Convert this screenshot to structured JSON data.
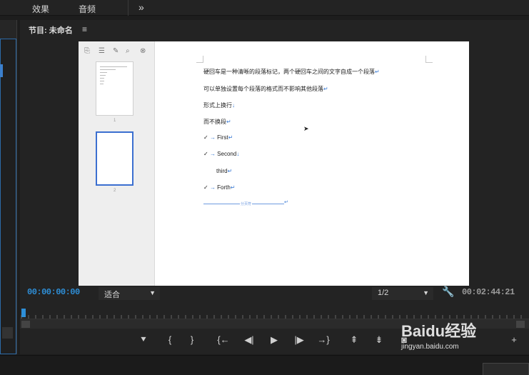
{
  "topbar": {
    "tab_effects": "效果",
    "tab_audio": "音频",
    "more_icon": "double-chevron-right"
  },
  "monitor": {
    "title": "节目: 未命名",
    "menu_icon": "hamburger",
    "timecode_current": "00:00:00:00",
    "fit_label": "适合",
    "resolution_label": "1/2",
    "timecode_duration": "00:02:44:21",
    "accent_color": "#2e8fd8"
  },
  "document": {
    "lines": [
      "硬回车是一种清晰的段落标记，两个硬回车之间的文字自成一个段落",
      "可以单独设置每个段落的格式而不影响其他段落",
      "形式上换行",
      "而不换段",
      "First",
      "Second",
      "third",
      "Forth"
    ],
    "page2_number": "2",
    "page1_number": "1",
    "divider_label": "分页符"
  },
  "transport": {
    "icons": [
      "marker-icon",
      "mark-in-icon",
      "mark-out-icon",
      "go-to-in-icon",
      "step-back-icon",
      "play-icon",
      "step-forward-icon",
      "go-to-out-icon",
      "lift-icon",
      "extract-icon",
      "export-frame-icon",
      "add-button-icon"
    ]
  },
  "watermark": {
    "logo": "Baidu经验",
    "url": "jingyan.baidu.com"
  }
}
